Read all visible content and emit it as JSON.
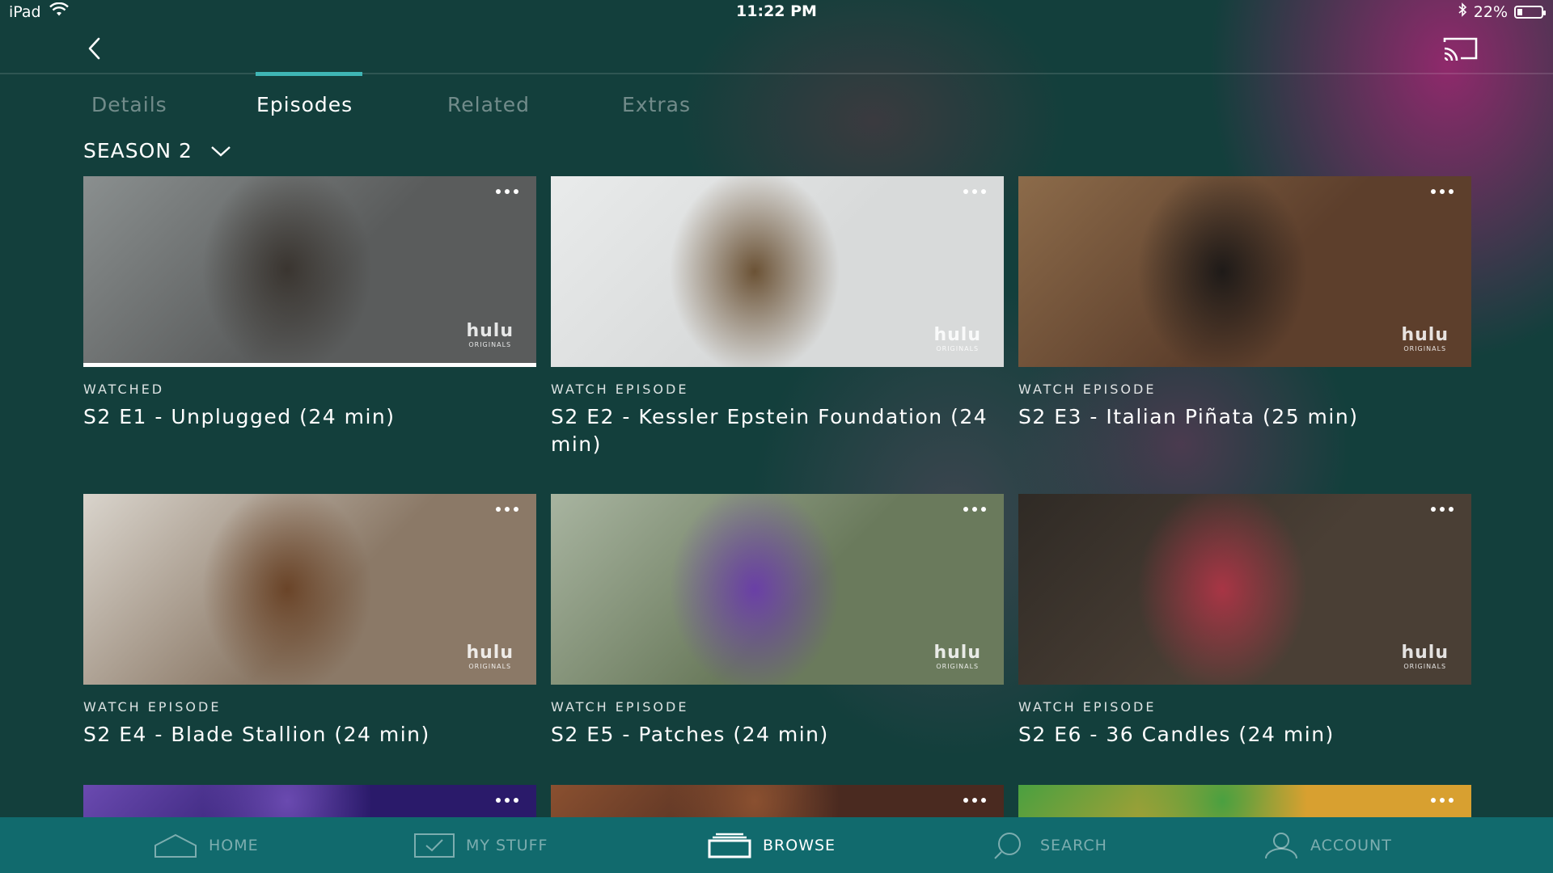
{
  "status_bar": {
    "device": "iPad",
    "time": "11:22 PM",
    "battery": "22%",
    "battery_level": 0.22
  },
  "header": {
    "back_icon": "chevron-left-icon",
    "cast_icon": "cast-icon"
  },
  "tabs": [
    {
      "label": "Details",
      "active": false
    },
    {
      "label": "Episodes",
      "active": true
    },
    {
      "label": "Related",
      "active": false
    },
    {
      "label": "Extras",
      "active": false
    }
  ],
  "season": {
    "label": "SEASON 2",
    "icon": "chevron-down-icon"
  },
  "thumb_logo": {
    "word": "hulu",
    "sub": "ORIGINALS"
  },
  "episodes": [
    {
      "status": "WATCHED",
      "title": "S2 E1 - Unplugged (24 min)",
      "watched": true,
      "colors": [
        "#5a5c5c",
        "#3a3530",
        "#8a8f8f"
      ]
    },
    {
      "status": "WATCH EPISODE",
      "title": "S2 E2 - Kessler Epstein Foundation (24 min)",
      "watched": false,
      "colors": [
        "#d8dada",
        "#6b5235",
        "#e9ebeb"
      ]
    },
    {
      "status": "WATCH EPISODE",
      "title": "S2 E3 - Italian Piñata (25 min)",
      "watched": false,
      "colors": [
        "#5d3f2c",
        "#1e1a18",
        "#8c6b4a"
      ]
    },
    {
      "status": "WATCH EPISODE",
      "title": "S2 E4 - Blade Stallion (24 min)",
      "watched": false,
      "colors": [
        "#8b7967",
        "#6a4428",
        "#d9d4cc"
      ]
    },
    {
      "status": "WATCH EPISODE",
      "title": "S2 E5 - Patches (24 min)",
      "watched": false,
      "colors": [
        "#6a7a5c",
        "#6a3fa6",
        "#a8b4a0"
      ]
    },
    {
      "status": "WATCH EPISODE",
      "title": "S2 E6 - 36 Candles (24 min)",
      "watched": false,
      "colors": [
        "#4a3f35",
        "#a83545",
        "#2f2a25"
      ]
    }
  ],
  "partial_row": [
    {
      "colors": [
        "#2a1a6a",
        "#6a4ab0"
      ]
    },
    {
      "colors": [
        "#4a2a20",
        "#8a5030"
      ]
    },
    {
      "colors": [
        "#d8a030",
        "#4aa040"
      ]
    }
  ],
  "bottom_nav": [
    {
      "label": "HOME",
      "icon": "home-icon",
      "active": false
    },
    {
      "label": "MY STUFF",
      "icon": "checkmark-box-icon",
      "active": false
    },
    {
      "label": "BROWSE",
      "icon": "browse-stack-icon",
      "active": true
    },
    {
      "label": "SEARCH",
      "icon": "search-icon",
      "active": false
    },
    {
      "label": "ACCOUNT",
      "icon": "account-icon",
      "active": false
    }
  ]
}
